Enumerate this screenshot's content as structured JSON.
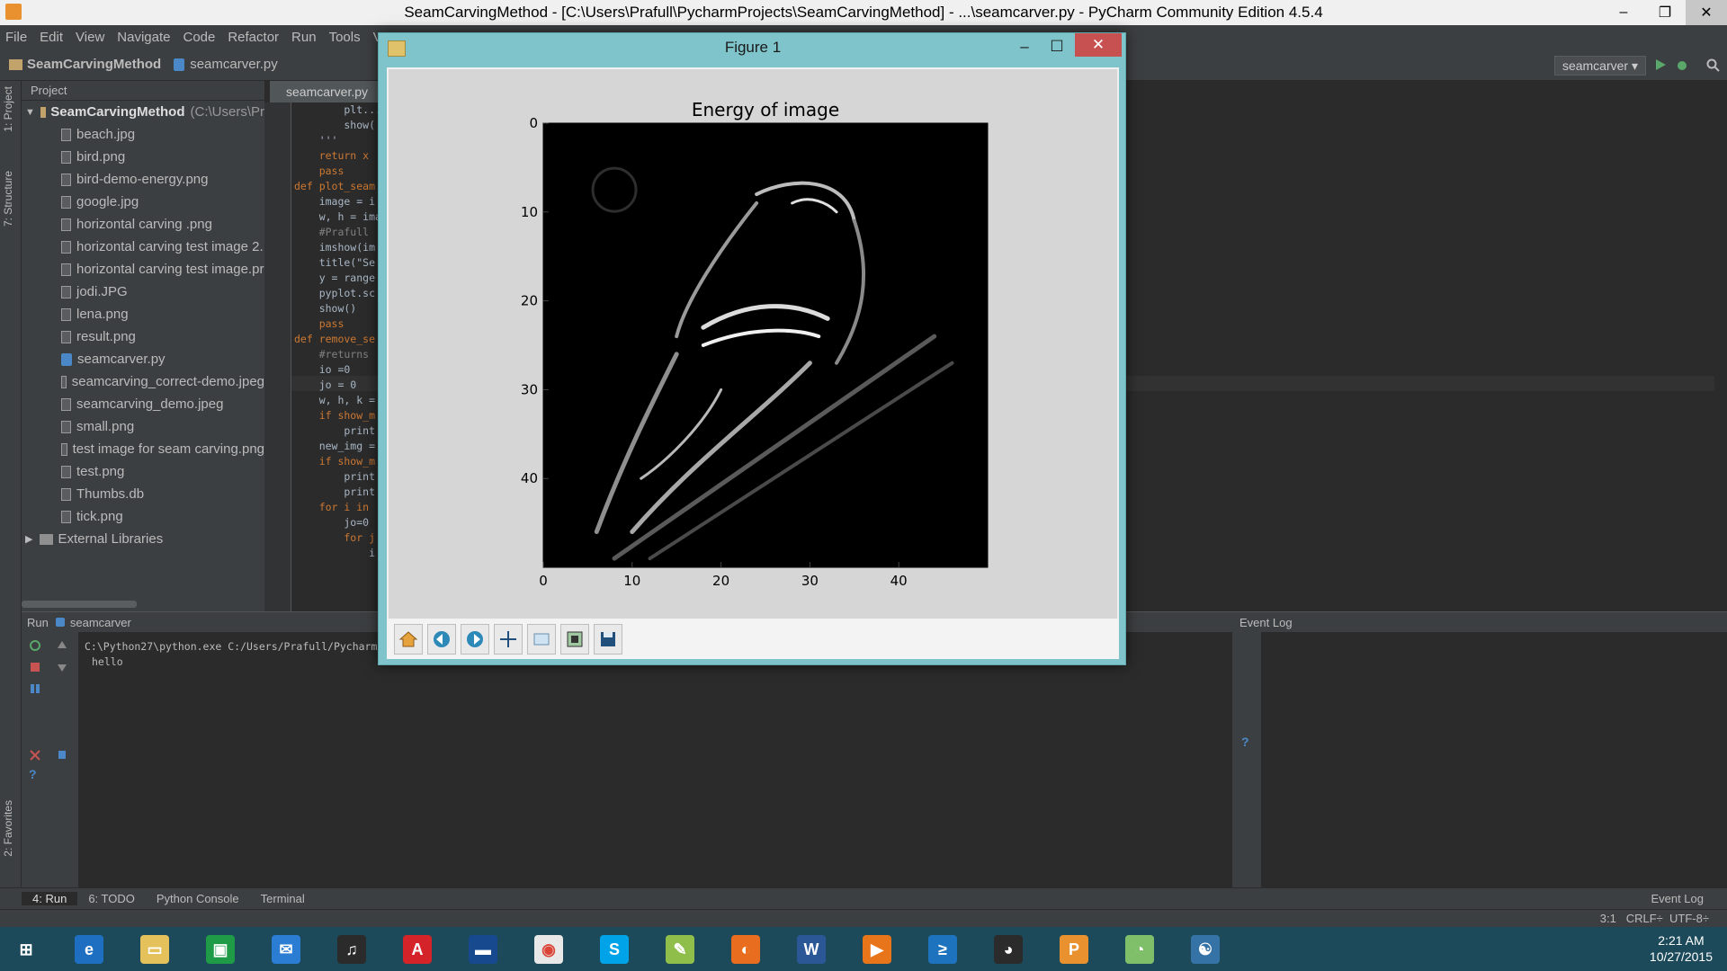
{
  "window": {
    "title": "SeamCarvingMethod - [C:\\Users\\Prafull\\PycharmProjects\\SeamCarvingMethod] - ...\\seamcarver.py - PyCharm Community Edition 4.5.4",
    "minimize": "–",
    "maximize": "❐",
    "close": "✕"
  },
  "menu": [
    "File",
    "Edit",
    "View",
    "Navigate",
    "Code",
    "Refactor",
    "Run",
    "Tools",
    "VC"
  ],
  "navbar": {
    "project": "SeamCarvingMethod",
    "file": "seamcarver.py",
    "run_config": "seamcarver ▾"
  },
  "sidebar_labels": {
    "project": "1: Project",
    "structure": "7: Structure",
    "favorites": "2: Favorites"
  },
  "project_panel": {
    "header": "Project",
    "root": "SeamCarvingMethod",
    "root_path": "(C:\\Users\\Pr",
    "files": [
      "beach.jpg",
      "bird.png",
      "bird-demo-energy.png",
      "google.jpg",
      "horizontal carving .png",
      "horizontal carving test image 2.",
      "horizontal carving test image.pr",
      "jodi.JPG",
      "lena.png",
      "result.png",
      "seamcarver.py",
      "seamcarving_correct-demo.jpeg",
      "seamcarving_demo.jpeg",
      "small.png",
      "test image for seam carving.png",
      "test.png",
      "Thumbs.db",
      "tick.png"
    ],
    "external": "External Libraries"
  },
  "editor": {
    "tab": "seamcarver.py",
    "lines": [
      "        plt...",
      "        show(",
      "    '''",
      "    return x",
      "    pass",
      "",
      "def plot_seam",
      "    image = i",
      "    w, h = ima",
      "    #Prafull",
      "    imshow(im",
      "    title(\"Se",
      "    y = range",
      "    pyplot.sc",
      "    show()",
      "    pass",
      "",
      "",
      "def remove_se",
      "    #returns",
      "    io =0",
      "    jo = 0",
      "    w, h, k =",
      "    if show_m",
      "        print",
      "    new_img =",
      "    if show_m",
      "        print",
      "        print",
      "    for i in",
      "        jo=0",
      "        for j",
      "            i"
    ]
  },
  "run_panel": {
    "header": "Run",
    "config": "seamcarver",
    "output": [
      "C:\\Python27\\python.exe C:/Users/Prafull/Pycharm",
      "hello"
    ]
  },
  "event_log": {
    "header": "Event Log"
  },
  "tool_buttons": [
    "4: Run",
    "6: TODO",
    "Python Console",
    "Terminal"
  ],
  "status_bar": {
    "event_log": "Event Log",
    "position": "3:1",
    "line_sep": "CRLF÷",
    "encoding": "UTF-8÷"
  },
  "figure": {
    "title": "Figure 1",
    "minimize": "–",
    "maximize": "☐",
    "close": "✕",
    "toolbar": [
      "home-icon",
      "back-arrow-icon",
      "forward-arrow-icon",
      "pan-icon",
      "zoom-icon",
      "configure-subplots-icon",
      "save-icon"
    ]
  },
  "chart_data": {
    "type": "heatmap",
    "title": "Energy of image",
    "xlabel": "",
    "ylabel": "",
    "xlim": [
      0,
      50
    ],
    "ylim": [
      50,
      0
    ],
    "xticks": [
      0,
      10,
      20,
      30,
      40
    ],
    "yticks": [
      0,
      10,
      20,
      30,
      40
    ],
    "colormap": "gray"
  },
  "taskbar": {
    "apps": [
      "windows-start",
      "internet-explorer",
      "file-explorer",
      "store",
      "mail",
      "headphones-app",
      "adobe",
      "remote-desktop",
      "chrome",
      "skype",
      "notepad",
      "firefox",
      "word",
      "media-player",
      "powershell",
      "github",
      "pycharm",
      "paint",
      "python"
    ],
    "time": "2:21 AM",
    "date": "10/27/2015"
  }
}
